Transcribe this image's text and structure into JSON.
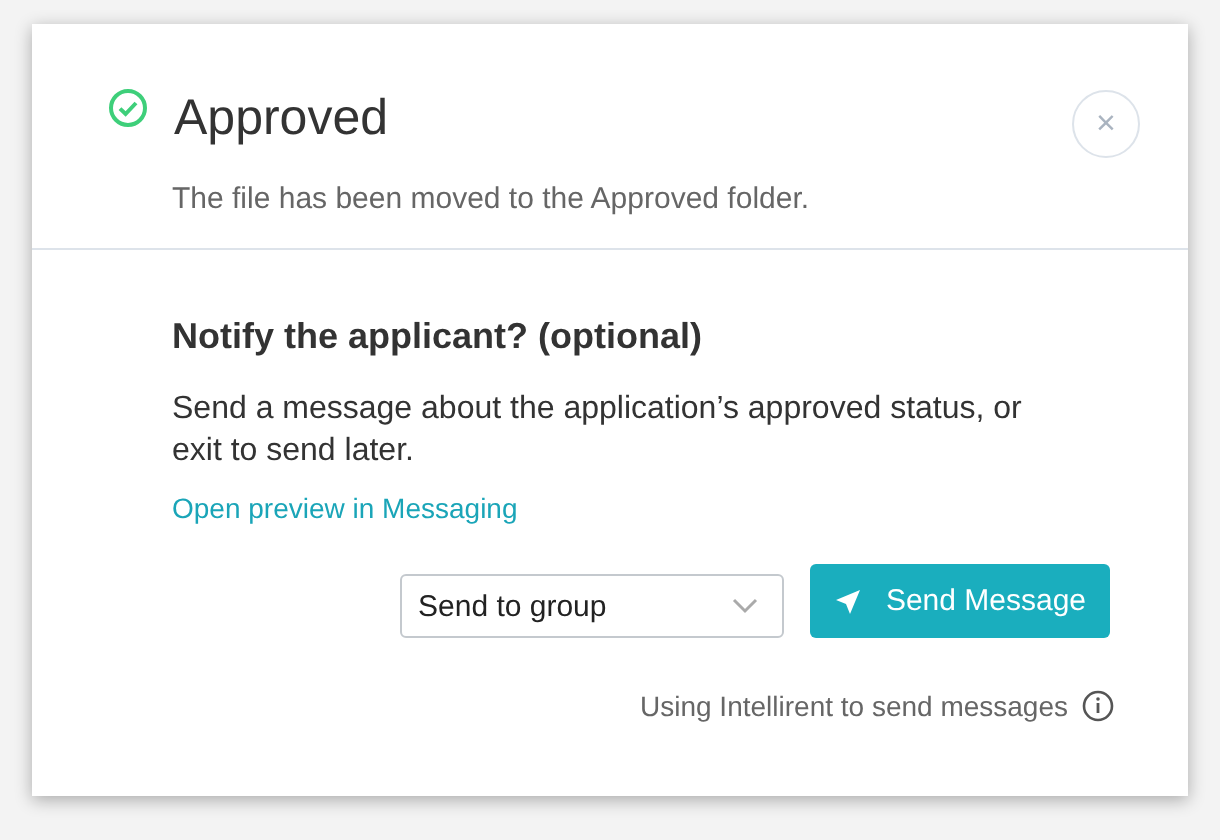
{
  "dialog": {
    "title": "Approved",
    "subtitle": "The file has been moved to the Approved folder.",
    "close": "×",
    "heading": "Notify the applicant? (optional)",
    "message": "Send a message about the application’s approved status, or exit to send later.",
    "link": "Open preview in Messaging",
    "recipient_select": {
      "value": "Send to group"
    },
    "send_button": "Send Message",
    "footnote": "Using Intellirent to send messages"
  }
}
